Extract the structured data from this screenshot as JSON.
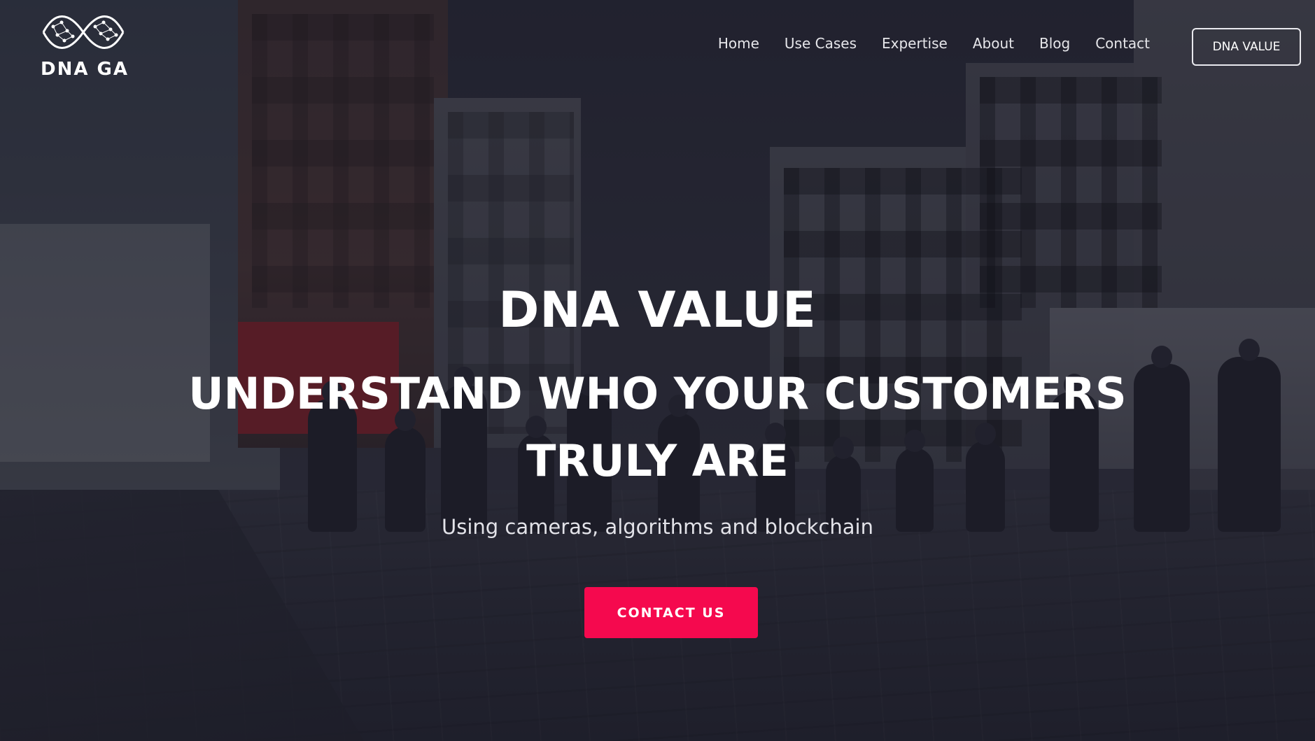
{
  "brand": {
    "name": "DNA GA",
    "logo_icon": "dna-helix-icon"
  },
  "nav": {
    "items": [
      {
        "label": "Home"
      },
      {
        "label": "Use Cases"
      },
      {
        "label": "Expertise"
      },
      {
        "label": "About"
      },
      {
        "label": "Blog"
      },
      {
        "label": "Contact"
      }
    ],
    "cta_label": "DNA VALUE"
  },
  "hero": {
    "title": "DNA VALUE",
    "heading_line1": "UNDERSTAND WHO YOUR CUSTOMERS",
    "heading_line2": "TRULY ARE",
    "subtitle": "Using cameras, algorithms and blockchain",
    "cta_label": "CONTACT US"
  },
  "colors": {
    "accent": "#f5094e",
    "overlay": "#1a1a26",
    "text": "#ffffff"
  }
}
